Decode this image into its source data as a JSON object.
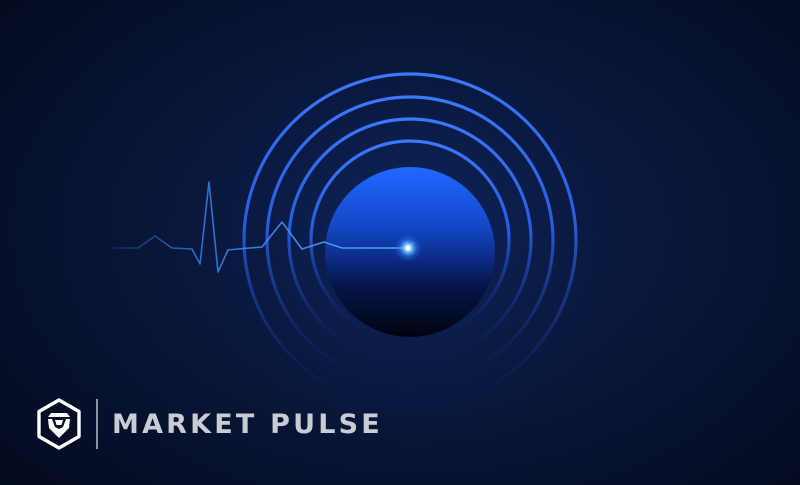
{
  "brand": {
    "name": "MARKET PULSE",
    "logo_icon": "crypto-lion-shield-icon"
  },
  "colors": {
    "background": "#06102a",
    "ring": "#2f6bff",
    "orb_top": "#1f63ff",
    "pulse_line": "#3d8bff",
    "text": "#c9ccd3",
    "divider": "#8a93a6"
  }
}
